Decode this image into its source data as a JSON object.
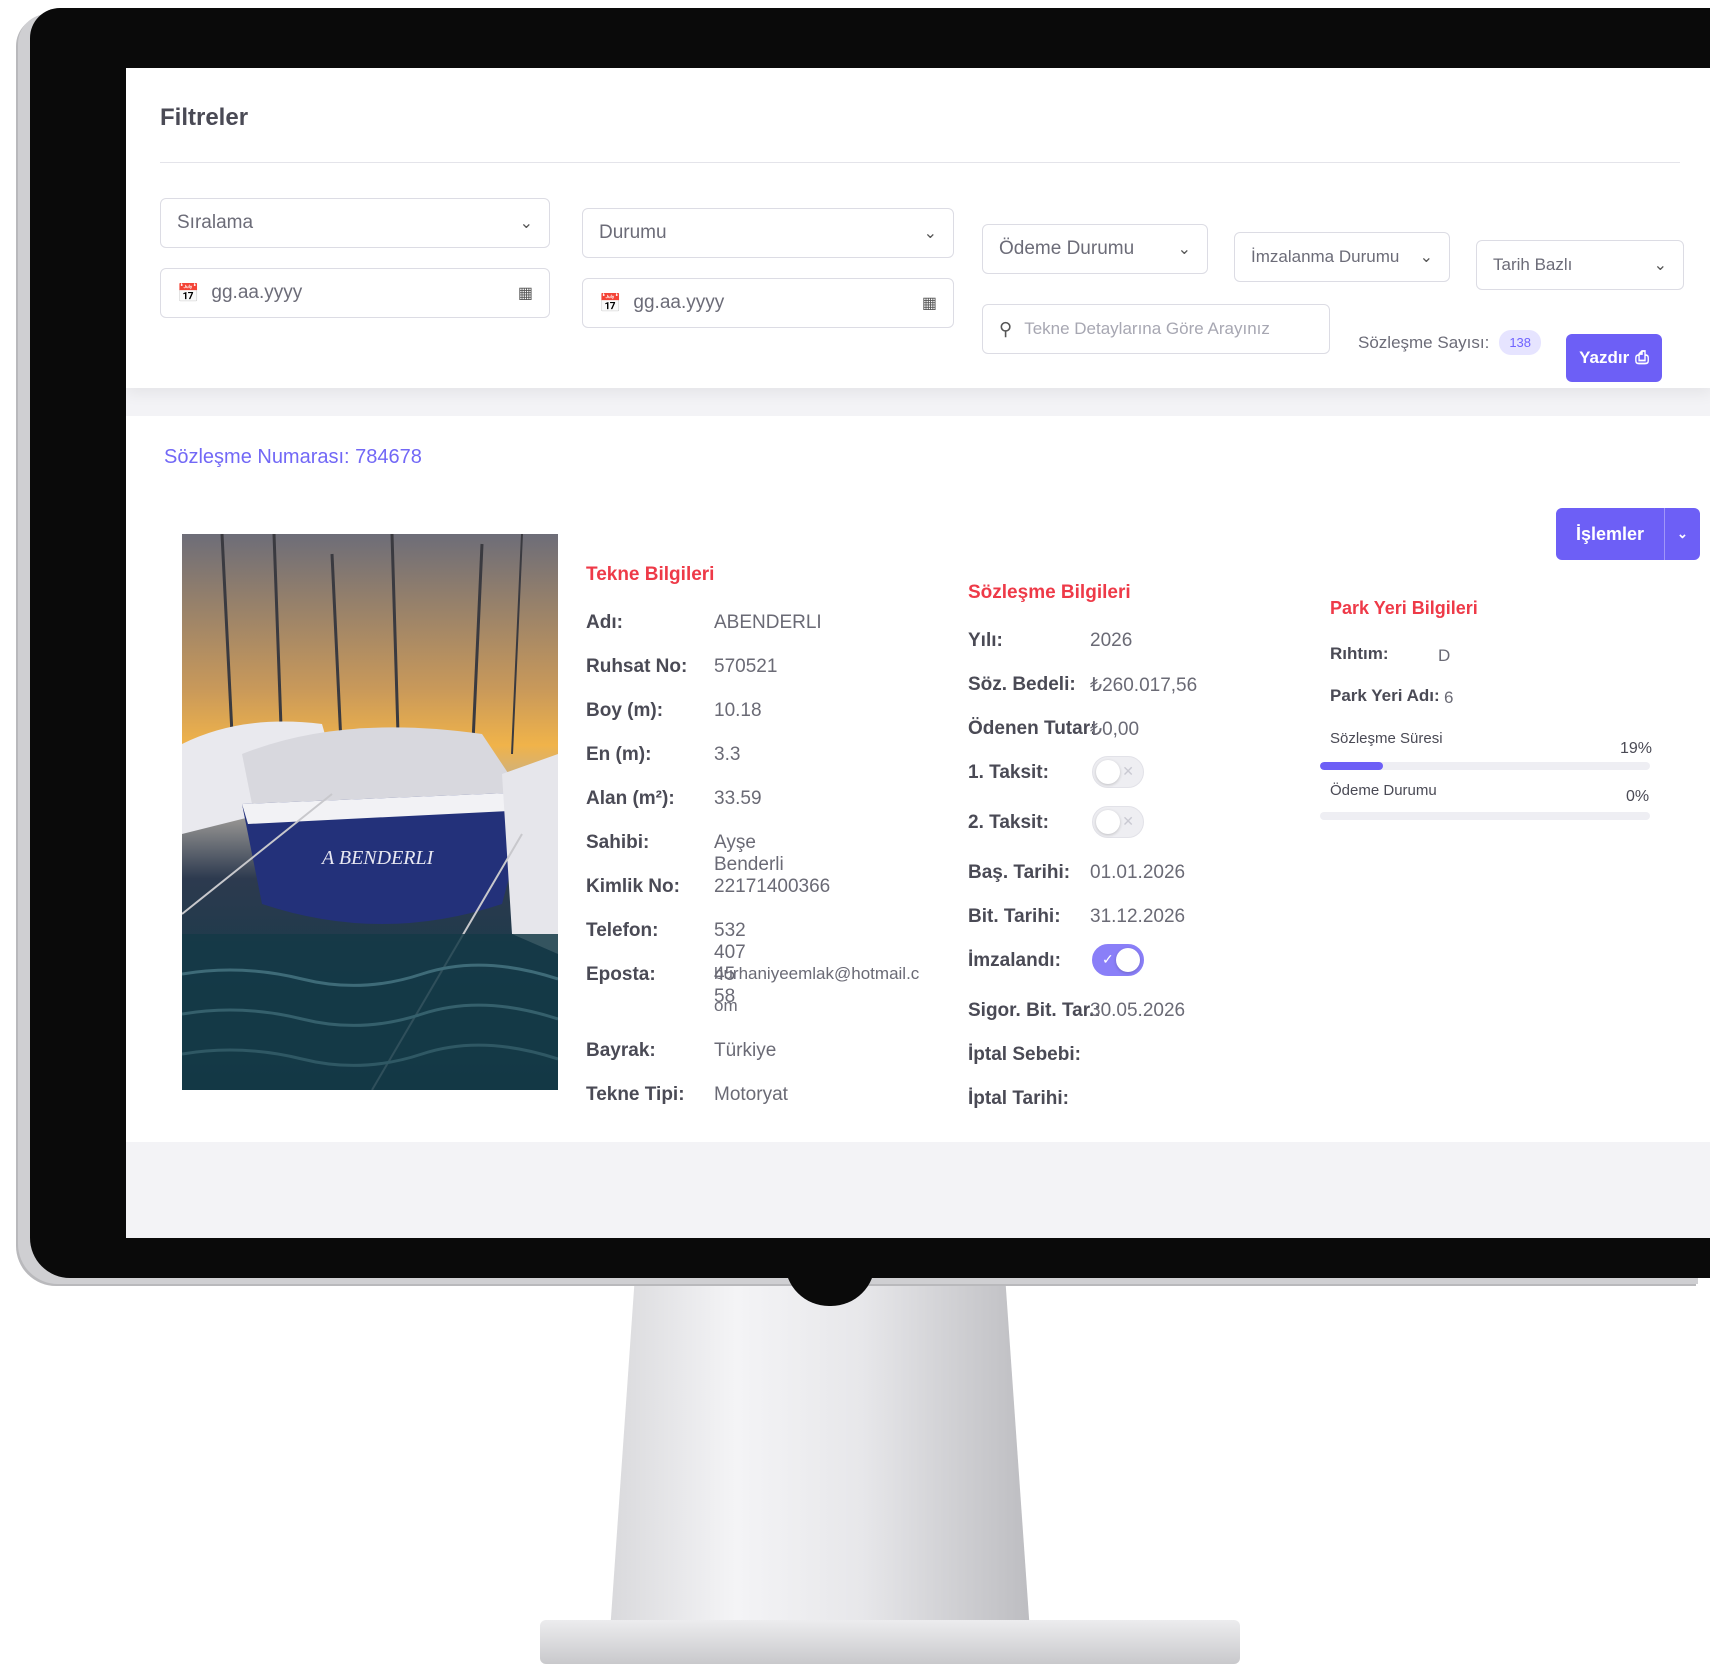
{
  "filters": {
    "title": "Filtreler",
    "sort_select": "Sıralama",
    "status_select": "Durumu",
    "payment_status_select": "Ödeme Durumu",
    "signing_status_select": "İmzalanma Durumu",
    "date_basis_select": "Tarih Bazlı",
    "start_date_placeholder": "gg.aa.yyyy",
    "end_date_placeholder": "gg.aa.yyyy",
    "search_placeholder": "Tekne Detaylarına Göre Arayınız",
    "contract_count_label": "Sözleşme Sayısı:",
    "contract_count": "138",
    "print_label": "Yazdır"
  },
  "contract": {
    "number_label": "Sözleşme Numarası: 784678",
    "actions_label": "İşlemler",
    "boat": {
      "title": "Tekne Bilgileri",
      "rows": [
        {
          "label": "Adı:",
          "value": "ABENDERLI"
        },
        {
          "label": "Ruhsat No:",
          "value": "570521"
        },
        {
          "label": "Boy (m):",
          "value": "10.18"
        },
        {
          "label": "En (m):",
          "value": "3.3"
        },
        {
          "label": "Alan (m²):",
          "value": "33.59"
        },
        {
          "label": "Sahibi:",
          "value": "Ayşe Benderli"
        },
        {
          "label": "Kimlik No:",
          "value": "22171400366"
        },
        {
          "label": "Telefon:",
          "value": "532 407 45 58"
        },
        {
          "label": "Eposta:",
          "value": "burhaniyeemlak@hotmail.c"
        },
        {
          "label": "",
          "value": "om"
        },
        {
          "label": "Bayrak:",
          "value": "Türkiye"
        },
        {
          "label": "Tekne Tipi:",
          "value": "Motoryat"
        }
      ]
    },
    "agreement": {
      "title": "Sözleşme Bilgileri",
      "year_label": "Yılı:",
      "year": "2026",
      "fee_label": "Söz. Bedeli:",
      "fee": "₺260.017,56",
      "paid_label": "Ödenen Tutar:",
      "paid": "₺0,00",
      "installment1_label": "1. Taksit:",
      "installment1_on": false,
      "installment2_label": "2. Taksit:",
      "installment2_on": false,
      "start_label": "Baş. Tarihi:",
      "start": "01.01.2026",
      "end_label": "Bit. Tarihi:",
      "end": "31.12.2026",
      "signed_label": "İmzalandı:",
      "signed_on": true,
      "insurance_label": "Sigor. Bit. Tar.:",
      "insurance": "30.05.2026",
      "cancel_reason_label": "İptal Sebebi:",
      "cancel_date_label": "İptal Tarihi:"
    },
    "parking": {
      "title": "Park Yeri Bilgileri",
      "pier_label": "Rıhtım:",
      "pier": "D",
      "spot_label": "Park Yeri Adı:",
      "spot": "6",
      "duration_label": "Sözleşme Süresi",
      "duration_pct": 19,
      "duration_pct_text": "19%",
      "payment_label": "Ödeme Durumu",
      "payment_pct": 0,
      "payment_pct_text": "0%"
    },
    "photo_caption": "A BENDERLI"
  },
  "colors": {
    "accent": "#6d5ff6",
    "section_title": "#ee3a48",
    "contract_link": "#7268f6"
  }
}
